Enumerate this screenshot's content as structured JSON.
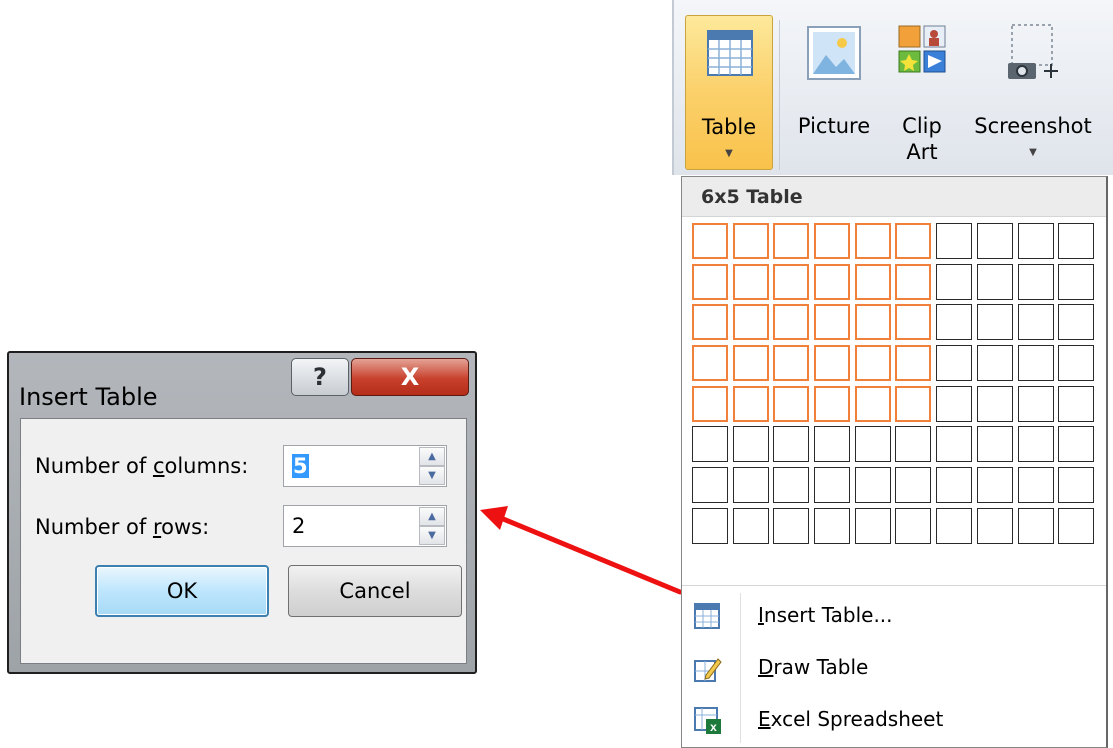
{
  "dialog": {
    "title": "Insert Table",
    "help_glyph": "?",
    "close_glyph": "X",
    "columns_label": {
      "pre": "Number of ",
      "hotkey": "c",
      "post": "olumns:"
    },
    "columns_value": "5",
    "rows_label": {
      "pre": "Number of ",
      "hotkey": "r",
      "post": "ows:"
    },
    "rows_value": "2",
    "ok_label": "OK",
    "cancel_label": "Cancel"
  },
  "ribbon": {
    "buttons": [
      {
        "name": "Table",
        "line2": "",
        "icon": "table-icon",
        "dropdown": true,
        "active": true
      },
      {
        "name": "Picture",
        "line2": "",
        "icon": "picture-icon",
        "dropdown": false
      },
      {
        "name": "Clip",
        "line2": "Art",
        "icon": "clip-art-icon",
        "dropdown": false
      },
      {
        "name": "Screenshot",
        "line2": "",
        "icon": "screenshot-icon",
        "dropdown": true
      }
    ]
  },
  "menu": {
    "header": "6x5 Table",
    "grid": {
      "columns": 10,
      "rows": 8,
      "highlight_columns": 6,
      "highlight_rows": 5
    },
    "items": [
      {
        "hotkey": "I",
        "rest": "nsert Table...",
        "icon": "insert-table-icon"
      },
      {
        "hotkey": "D",
        "rest": "raw Table",
        "icon": "draw-table-icon"
      },
      {
        "hotkey": "E",
        "rest": "xcel Spreadsheet",
        "icon": "excel-spreadsheet-icon"
      }
    ]
  },
  "colors": {
    "highlight": "#f0803a",
    "active_button": "#fbd06a",
    "arrow": "#ee1111",
    "close_button": "#c8412c"
  }
}
